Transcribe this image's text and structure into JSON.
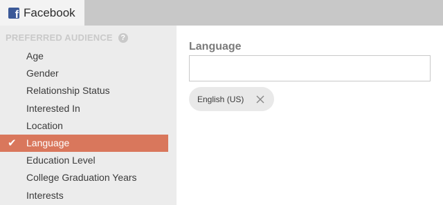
{
  "tab": {
    "icon": "facebook-logo-icon",
    "icon_letter": "f",
    "label": "Facebook"
  },
  "sidebar": {
    "header": "PREFERRED AUDIENCE",
    "help_icon": "?",
    "items": [
      {
        "label": "Age",
        "active": false
      },
      {
        "label": "Gender",
        "active": false
      },
      {
        "label": "Relationship Status",
        "active": false
      },
      {
        "label": "Interested In",
        "active": false
      },
      {
        "label": "Location",
        "active": false
      },
      {
        "label": "Language",
        "active": true
      },
      {
        "label": "Education Level",
        "active": false
      },
      {
        "label": "College Graduation Years",
        "active": false
      },
      {
        "label": "Interests",
        "active": false
      }
    ]
  },
  "main": {
    "field_label": "Language",
    "input_value": "",
    "chips": [
      {
        "label": "English (US)",
        "remove_icon": "close-icon"
      }
    ]
  },
  "colors": {
    "active_item": "#d9775c",
    "facebook_blue": "#3b5998",
    "topbar": "#c8c8c8",
    "sidebar": "#ececec"
  }
}
